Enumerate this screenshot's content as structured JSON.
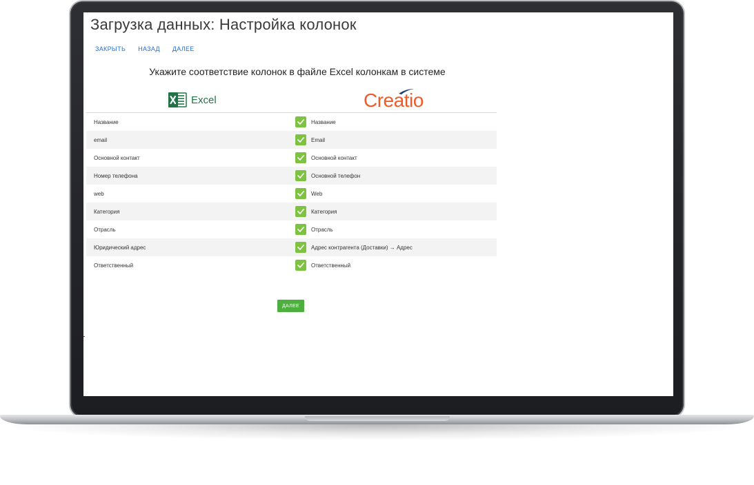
{
  "page_title": "Загрузка данных: Настройка колонок",
  "actions": {
    "close": "ЗАКРЫТЬ",
    "back": "НАЗАД",
    "next": "ДАЛЕЕ"
  },
  "instruction": "Укажите соответствие колонок в файле Excel колонкам в системе",
  "brands": {
    "excel": "Excel",
    "creatio": "Creatio"
  },
  "mappings": [
    {
      "excel": "Название",
      "system": "Название"
    },
    {
      "excel": "email",
      "system": "Email"
    },
    {
      "excel": "Основной контакт",
      "system": "Основной контакт"
    },
    {
      "excel": "Номер телефона",
      "system": "Основной телефон"
    },
    {
      "excel": "web",
      "system": "Web"
    },
    {
      "excel": "Категория",
      "system": "Категория"
    },
    {
      "excel": "Отрасль",
      "system": "Отрасль"
    },
    {
      "excel": "Юридический адрес",
      "system": "Адрес контрагента (Доставки) → Адрес"
    },
    {
      "excel": "Ответственный",
      "system": "Ответственный"
    }
  ],
  "next_button": "ДАЛЕЕ",
  "colors": {
    "accent_link": "#1f6fd1",
    "check": "#7ec241",
    "button": "#4caf3e",
    "excel_green": "#217346",
    "creatio_orange": "#f15a29"
  }
}
